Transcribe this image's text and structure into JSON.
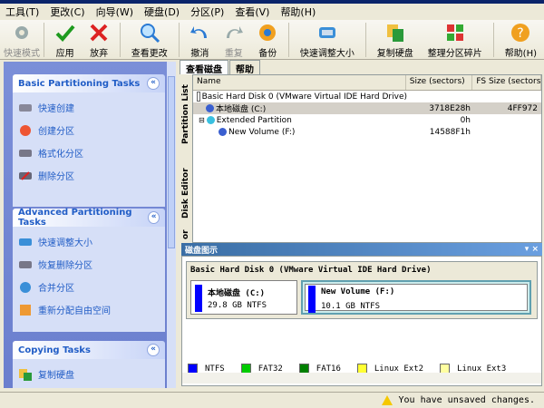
{
  "menu": [
    "工具(T)",
    "更改(C)",
    "向导(W)",
    "硬盘(D)",
    "分区(P)",
    "查看(V)",
    "帮助(H)"
  ],
  "toolbar": {
    "fast_mode": "快速模式",
    "apply": "应用",
    "discard": "放弃",
    "view_changes": "查看更改",
    "undo": "撤消",
    "redo": "重复",
    "backup": "备份",
    "quick_resize": "快速调整大小",
    "copy_disk": "复制硬盘",
    "defrag": "整理分区碎片",
    "help": "帮助(H)"
  },
  "left": {
    "basic": {
      "title": "Basic Partitioning Tasks",
      "items": [
        "快速创建",
        "创建分区",
        "格式化分区",
        "删除分区"
      ]
    },
    "advanced": {
      "title": "Advanced Partitioning Tasks",
      "items": [
        "快速调整大小",
        "恢复删除分区",
        "合并分区",
        "重新分配自由空间"
      ]
    },
    "copying": {
      "title": "Copying Tasks",
      "items": [
        "复制硬盘"
      ]
    }
  },
  "tabs": [
    "查看磁盘",
    "帮助"
  ],
  "vtabs": [
    "Partition List",
    "Disk Editor",
    "or"
  ],
  "table": {
    "headers": [
      "Name",
      "Size (sectors)",
      "FS Size (sectors"
    ],
    "rows": [
      {
        "name": "Basic Hard Disk 0 (VMware Virtual IDE Hard Drive)",
        "size": "",
        "fs": ""
      },
      {
        "name": "本地磁盘 (C:)",
        "size": "3718E28h",
        "fs": "4FF972"
      },
      {
        "name": "Extended Partition",
        "size": "0h",
        "fs": ""
      },
      {
        "name": "New Volume (F:)",
        "size": "14588F1h",
        "fs": ""
      }
    ]
  },
  "diskmap": {
    "header": "磁盘图示",
    "header_ctrl": "▾ ×",
    "disk_title": "Basic Hard Disk 0 (VMware Virtual IDE Hard Drive)",
    "partitions": [
      {
        "name": "本地磁盘 (C:)",
        "info": "29.8 GB NTFS"
      },
      {
        "name": "New Volume (F:)",
        "info": "10.1 GB NTFS"
      }
    ],
    "legend": [
      {
        "label": "NTFS",
        "color": "#0000ff"
      },
      {
        "label": "FAT32",
        "color": "#00cc00"
      },
      {
        "label": "FAT16",
        "color": "#008000"
      },
      {
        "label": "Linux Ext2",
        "color": "#ffff33"
      },
      {
        "label": "Linux Ext3",
        "color": "#ffffa0"
      }
    ]
  },
  "status": "You have unsaved changes."
}
